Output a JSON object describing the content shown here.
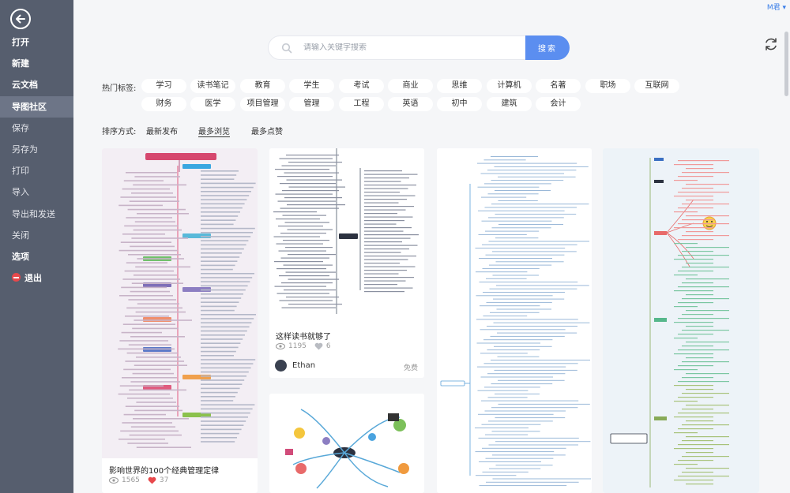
{
  "user": {
    "name": "M君"
  },
  "sidebar": {
    "items": [
      {
        "label": "打开",
        "style": "bold"
      },
      {
        "label": "新建",
        "style": "bold"
      },
      {
        "label": "云文档",
        "style": "bold"
      },
      {
        "label": "导图社区",
        "style": "bold",
        "active": true
      },
      {
        "label": "保存",
        "style": "dim"
      },
      {
        "label": "另存为",
        "style": "dim"
      },
      {
        "label": "打印",
        "style": "dim"
      },
      {
        "label": "导入",
        "style": "dim"
      },
      {
        "label": "导出和发送",
        "style": "dim"
      },
      {
        "label": "关闭",
        "style": "dim"
      },
      {
        "label": "选项",
        "style": "bold"
      },
      {
        "label": "退出",
        "style": "bold",
        "icon": "exit-icon"
      }
    ]
  },
  "search": {
    "placeholder": "请输入关键字搜索",
    "button": "搜索"
  },
  "tags": {
    "label": "热门标签:",
    "row1": [
      "学习",
      "读书笔记",
      "教育",
      "学生",
      "考试",
      "商业",
      "思维",
      "计算机",
      "名著",
      "职场",
      "互联网"
    ],
    "row2": [
      "财务",
      "医学",
      "项目管理",
      "管理",
      "工程",
      "英语",
      "初中",
      "建筑",
      "会计"
    ]
  },
  "sort": {
    "label": "排序方式:",
    "options": [
      "最新发布",
      "最多浏览",
      "最多点赞"
    ],
    "active": 1
  },
  "cards": [
    {
      "title": "影响世界的100个经典管理定律",
      "views": "1565",
      "likes": "37",
      "liked": true
    },
    {
      "title": "这样读书就够了",
      "views": "1195",
      "likes": "6",
      "liked": false,
      "author": "Ethan",
      "price": "免费"
    }
  ],
  "colors": {
    "sidebar": "#565e6e",
    "accent": "#5b8ef0",
    "like": "#e8484b"
  }
}
